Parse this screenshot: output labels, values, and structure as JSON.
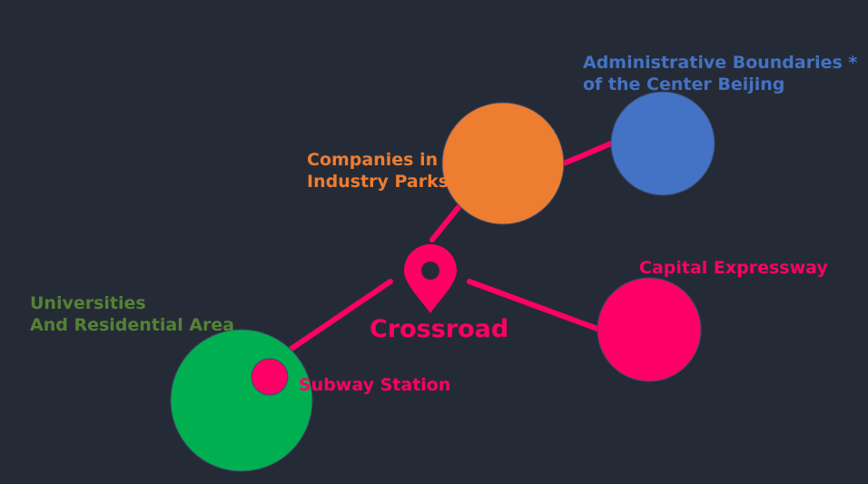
{
  "nodes": {
    "crossroad": {
      "label": "Crossroad",
      "color": "#ff0066"
    },
    "companies": {
      "label": "Companies in\nIndustry Parks",
      "color": "#ed7d31"
    },
    "administrative": {
      "label": "Administrative Boundaries *\nof the Center Beijing",
      "color": "#4472c4"
    },
    "capital_expressway": {
      "label": "Capital Expressway",
      "color": "#ff0066"
    },
    "universities": {
      "label": "Universities\nAnd Residential Area",
      "color": "#00b050",
      "label_color": "#548235"
    },
    "subway": {
      "label": "Subway Station",
      "color": "#ff0066"
    }
  },
  "colors": {
    "background": "#252b36",
    "connector": "#ff0066"
  },
  "icons": {
    "crossroad": "map-pin-icon"
  }
}
